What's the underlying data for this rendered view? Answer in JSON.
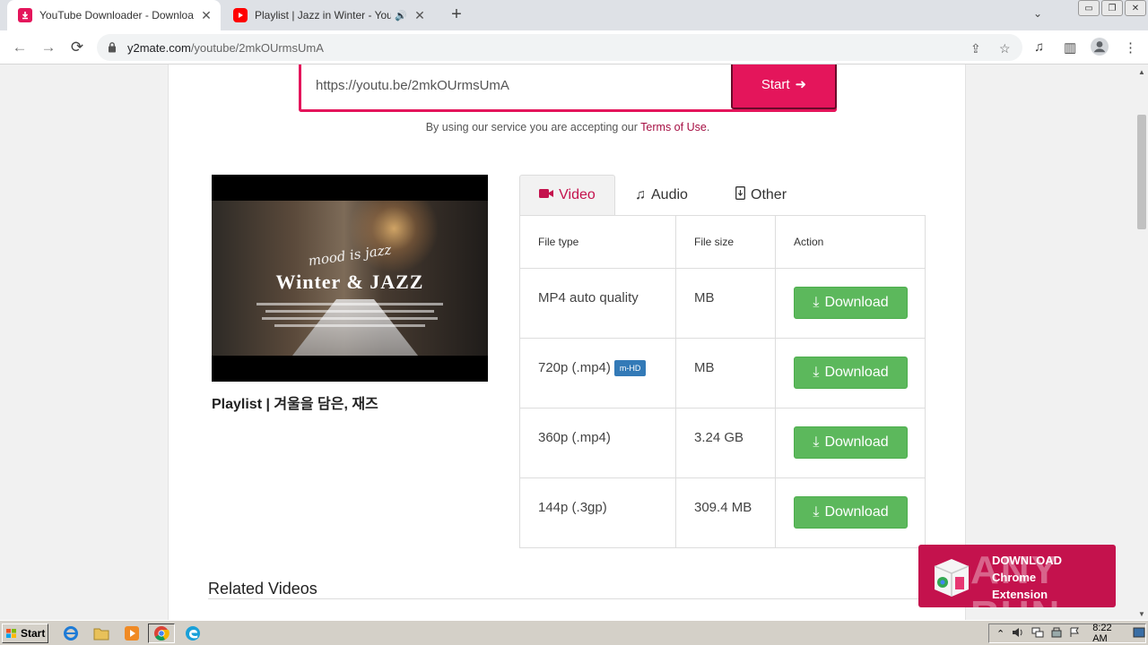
{
  "browser": {
    "tabs": [
      {
        "title": "YouTube Downloader - Download Yo"
      },
      {
        "title": "Playlist | Jazz in Winter - YouTub"
      }
    ],
    "tab_close": "✕",
    "speaker": "🔊",
    "new_tab": "+",
    "tab_menu": "⌄",
    "window_controls": {
      "minimize": "▭",
      "restore": "❐",
      "close": "✕"
    },
    "nav": {
      "back": "←",
      "forward": "→",
      "reload": "⟳"
    },
    "url_host": "y2mate.com",
    "url_path": "/youtube/2mkOUrmsUmA",
    "toolbar_icons": {
      "share": "⇪",
      "star": "☆",
      "media": "♫",
      "sidepanel": "▥",
      "profile": "●",
      "menu": "⋮"
    }
  },
  "search": {
    "value": "https://youtu.be/2mkOUrmsUmA",
    "start_label": "Start",
    "start_arrow": "➜"
  },
  "terms": {
    "prefix": "By using our service you are accepting our ",
    "link": "Terms of Use",
    "suffix": "."
  },
  "video": {
    "thumb_script": "mood is jazz",
    "thumb_title": "Winter & JAZZ",
    "title": "Playlist | 겨울을 담은, 재즈"
  },
  "format_tabs": [
    {
      "icon": "■",
      "label": "Video"
    },
    {
      "icon": "♫",
      "label": "Audio"
    },
    {
      "icon": "▯",
      "label": "Other"
    }
  ],
  "table": {
    "headers": [
      "File type",
      "File size",
      "Action"
    ],
    "rows": [
      {
        "type": "MP4 auto quality",
        "badge": "",
        "size": "MB",
        "action": "Download"
      },
      {
        "type": "720p (.mp4)",
        "badge": "m-HD",
        "size": "MB",
        "action": "Download"
      },
      {
        "type": "360p (.mp4)",
        "badge": "",
        "size": "3.24 GB",
        "action": "Download"
      },
      {
        "type": "144p (.3gp)",
        "badge": "",
        "size": "309.4 MB",
        "action": "Download"
      }
    ],
    "download_icon": "⤓"
  },
  "related_title": "Related Videos",
  "extension_banner": {
    "line1": "DOWNLOAD",
    "line2": "Chrome",
    "line3": "Extension",
    "watermark": "ANY RUN"
  },
  "taskbar": {
    "start": "Start",
    "clock": "8:22 AM",
    "tray_expand": "⌃"
  },
  "colors": {
    "brand": "#e4155b",
    "download_green": "#5cb85c",
    "badge_blue": "#337ab7"
  }
}
